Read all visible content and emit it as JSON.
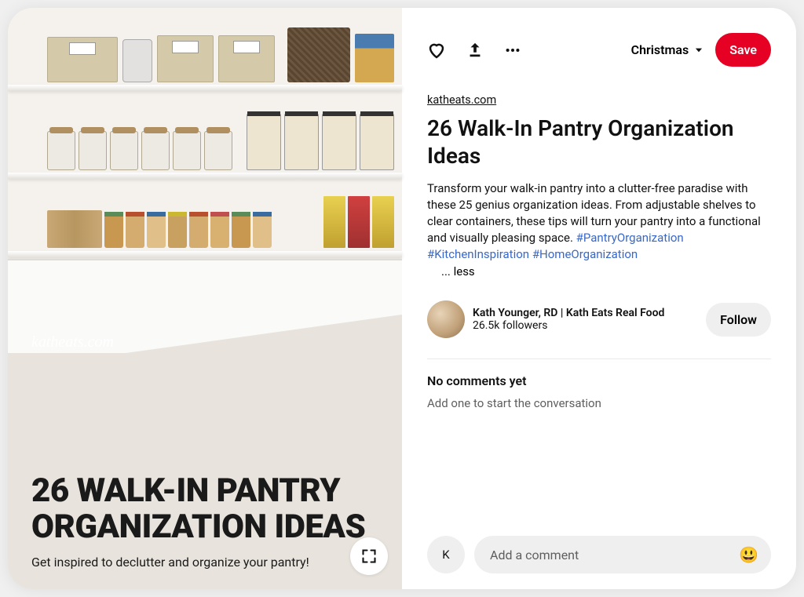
{
  "board_name": "Christmas",
  "save_label": "Save",
  "source_domain": "katheats.com",
  "title": "26 Walk-In Pantry Organization Ideas",
  "description_text": "Transform your walk-in pantry into a clutter-free paradise with these 25 genius organization ideas. From adjustable shelves to clear containers, these tips will turn your pantry into a functional and visually pleasing space. ",
  "hashtags": [
    "#PantryOrganization",
    "#KitchenInspiration",
    "#HomeOrganization"
  ],
  "less_toggle": "... less",
  "creator": {
    "name": "Kath Younger, RD | Kath Eats Real Food",
    "followers": "26.5k followers"
  },
  "follow_label": "Follow",
  "comments": {
    "header": "No comments yet",
    "empty_prompt": "Add one to start the conversation"
  },
  "current_user_initial": "K",
  "comment_placeholder": "Add a comment",
  "image_overlay": {
    "watermark": "katheats.com",
    "heading": "26 WALK-IN PANTRY ORGANIZATION IDEAS",
    "subheading": "Get inspired to declutter and organize your pantry!"
  },
  "colors": {
    "accent_red": "#e60023",
    "link_blue": "#3868c9"
  }
}
